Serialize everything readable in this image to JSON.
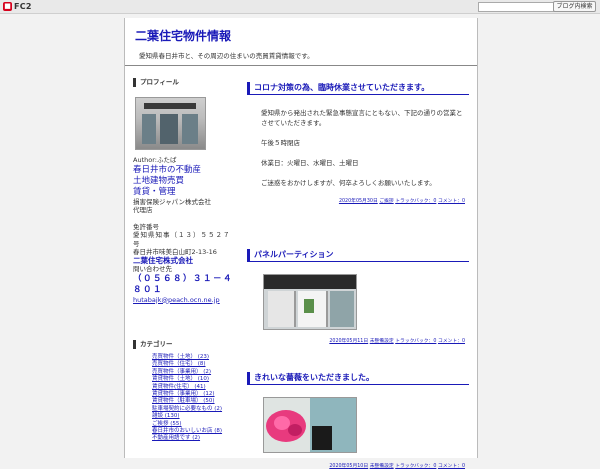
{
  "topbar": {
    "logo_text": "FC2",
    "search_placeholder": "",
    "search_button": "ブログ内検索"
  },
  "header": {
    "title": "二葉住宅物件情報",
    "description": "愛知県春日井市と、その周辺の住まいの売買賃貸情報です。"
  },
  "sidebar": {
    "profile_heading": "プロフィール",
    "author": "Author:ふたば",
    "lines_blue": [
      "春日井市の不動産",
      "土地建物売買",
      "賃貸・管理"
    ],
    "lines_plain": [
      "損害保険ジャパン株式会社",
      "代理店"
    ],
    "license_label": "免許番号",
    "license_no": "愛知県知事（１３）５５２７号",
    "address": "春日井市味美白山町2-13-16",
    "company": "二葉住宅株式会社",
    "contact_label": "問い合わせ先",
    "tel": "（０５６８）３１－４８０１",
    "email": "hutabajk@peach.ocn.ne.jp",
    "category_heading": "カテゴリー",
    "categories": [
      "売買物件（土地） (23)",
      "売買物件（住宅） (8)",
      "売買物件（事業用） (2)",
      "賃貸物件（土地） (10)",
      "賃貸物件(住宅） (41)",
      "賃貸物件（事業用） (12)",
      "賃貸物件（駐車場） (50)",
      "駐車場契約に必要なもの (2)",
      "雑談 (130)",
      "ご挨拶 (55)",
      "春日井市のおいしいお店 (8)",
      "不動産用語です (2)"
    ]
  },
  "entries": [
    {
      "title": "コロナ対策の為、臨時休業させていただきます。",
      "body": [
        "愛知県から発出された緊急事態宣言にともない、下記の通りの営業とさせていただきます。",
        "",
        "午後５時閉店",
        "",
        "休業日：火曜日、水曜日、土曜日",
        "",
        "ご迷惑をおかけしますが、何卒よろしくお願いいたします。"
      ],
      "date": "2020年05月30日",
      "category": "ご挨拶",
      "trackback": "トラックバック：0",
      "comment": "コメント：0"
    },
    {
      "title": "パネルパーティション",
      "date": "2020年05月11日",
      "category": "未整備設定",
      "trackback": "トラックバック：0",
      "comment": "コメント：0"
    },
    {
      "title": "きれいな薔薇をいただきました。",
      "date": "2020年05月10日",
      "category": "未整備設定",
      "trackback": "トラックバック：0",
      "comment": "コメント：0"
    }
  ],
  "colors": {
    "accent": "#1a1ab8",
    "background": "#f2f2f2",
    "panel": "#ffffff"
  }
}
